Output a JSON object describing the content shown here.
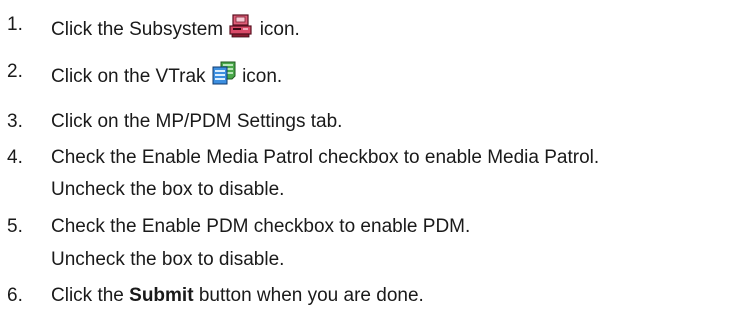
{
  "steps": [
    {
      "num": "1.",
      "before": "Click the Subsystem",
      "icon": "subsystem-icon",
      "after": "icon."
    },
    {
      "num": "2.",
      "before": "Click on the VTrak",
      "icon": "vtrak-icon",
      "after": "icon."
    },
    {
      "num": "3.",
      "text": "Click on the MP/PDM Settings tab."
    },
    {
      "num": "4.",
      "text": "Check the Enable Media Patrol checkbox to enable Media Patrol.",
      "continuation": "Uncheck the box to disable."
    },
    {
      "num": "5.",
      "text": "Check the Enable PDM checkbox to enable PDM.",
      "continuation": "Uncheck the box to disable."
    },
    {
      "num": "6.",
      "before": "Click the",
      "bold": "Submit",
      "after": "button when you are done."
    }
  ]
}
